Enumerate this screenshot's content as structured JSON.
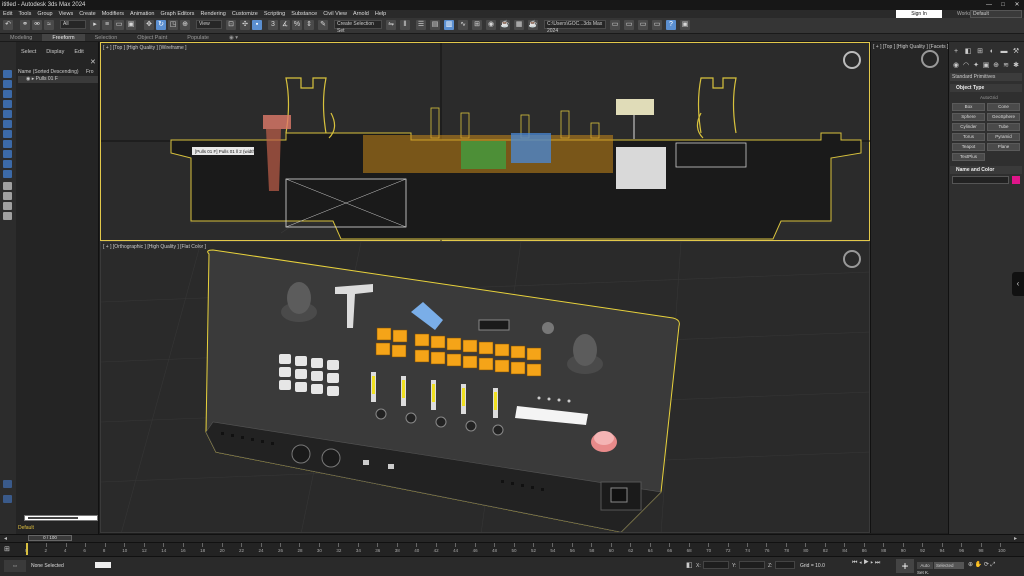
{
  "window": {
    "title": "ititled - Autodesk 3ds Max 2024",
    "controls": [
      "—",
      "□",
      "✕"
    ]
  },
  "menu": [
    "Edit",
    "Tools",
    "Group",
    "Views",
    "Create",
    "Modifiers",
    "Animation",
    "Graph Editors",
    "Rendering",
    "Customize",
    "Scripting",
    "Substance",
    "Civil View",
    "Arnold",
    "Help"
  ],
  "account": {
    "signin": "Sign In",
    "workspace_label": "Workspaces:",
    "workspace_value": "Default"
  },
  "toolbar": {
    "filter": "All",
    "view": "View",
    "selection_set": "Create Selection Set",
    "path": "C:\\Users\\GOC...3ds Max 2024"
  },
  "ribbon": {
    "tabs": [
      "Modeling",
      "Freeform",
      "Selection",
      "Object Paint",
      "Populate"
    ],
    "active": "Freeform"
  },
  "scene_explorer": {
    "menu": [
      "Select",
      "Display",
      "Edit"
    ],
    "filter_label": "Name (Sorted Descending)",
    "filter_suffix": "Fro",
    "row": "Pulls 01 F",
    "layer": "Default"
  },
  "viewports": {
    "top": {
      "label": "[ + ] [Top ] [High Quality ] [Wireframe ]",
      "tooltip": "[Pulls 01 F] Pulls 01 ll 2 (width)"
    },
    "ortho": {
      "label": "[ + ] [Orthographic ] [High Quality ] [Flat Color ]"
    },
    "right": {
      "label": "[ + ] [Top ] [High Quality ] [Facets ]"
    }
  },
  "command_panel": {
    "primitives": "Standard Primitives",
    "object_type": "Object Type",
    "autogrid": "AutoGrid",
    "buttons": [
      "Box",
      "Cone",
      "Sphere",
      "GeoSphere",
      "Cylinder",
      "Tube",
      "Torus",
      "Pyramid",
      "Teapot",
      "Plane",
      "TextPlus"
    ],
    "name_color": "Name and Color",
    "swatch_color": "#e0158a"
  },
  "timeline": {
    "slider": "0 / 100",
    "ticks": [
      "0",
      "2",
      "4",
      "6",
      "8",
      "10",
      "12",
      "14",
      "16",
      "18",
      "20",
      "22",
      "24",
      "26",
      "28",
      "30",
      "32",
      "34",
      "36",
      "38",
      "40",
      "42",
      "44",
      "46",
      "48",
      "50",
      "52",
      "54",
      "56",
      "58",
      "60",
      "62",
      "64",
      "66",
      "68",
      "70",
      "72",
      "74",
      "76",
      "78",
      "80",
      "82",
      "84",
      "86",
      "88",
      "90",
      "92",
      "94",
      "96",
      "98",
      "100"
    ]
  },
  "status": {
    "text": "None Selected",
    "x_label": "X:",
    "y_label": "Y:",
    "z_label": "Z:",
    "grid": "Grid = 10.0",
    "auto": "Auto",
    "selected": "Selected",
    "setk": "Set K."
  },
  "colors": {
    "accent": "#5b8fd0",
    "highlight": "#e2c84a",
    "key_orange": "#f5a418"
  }
}
